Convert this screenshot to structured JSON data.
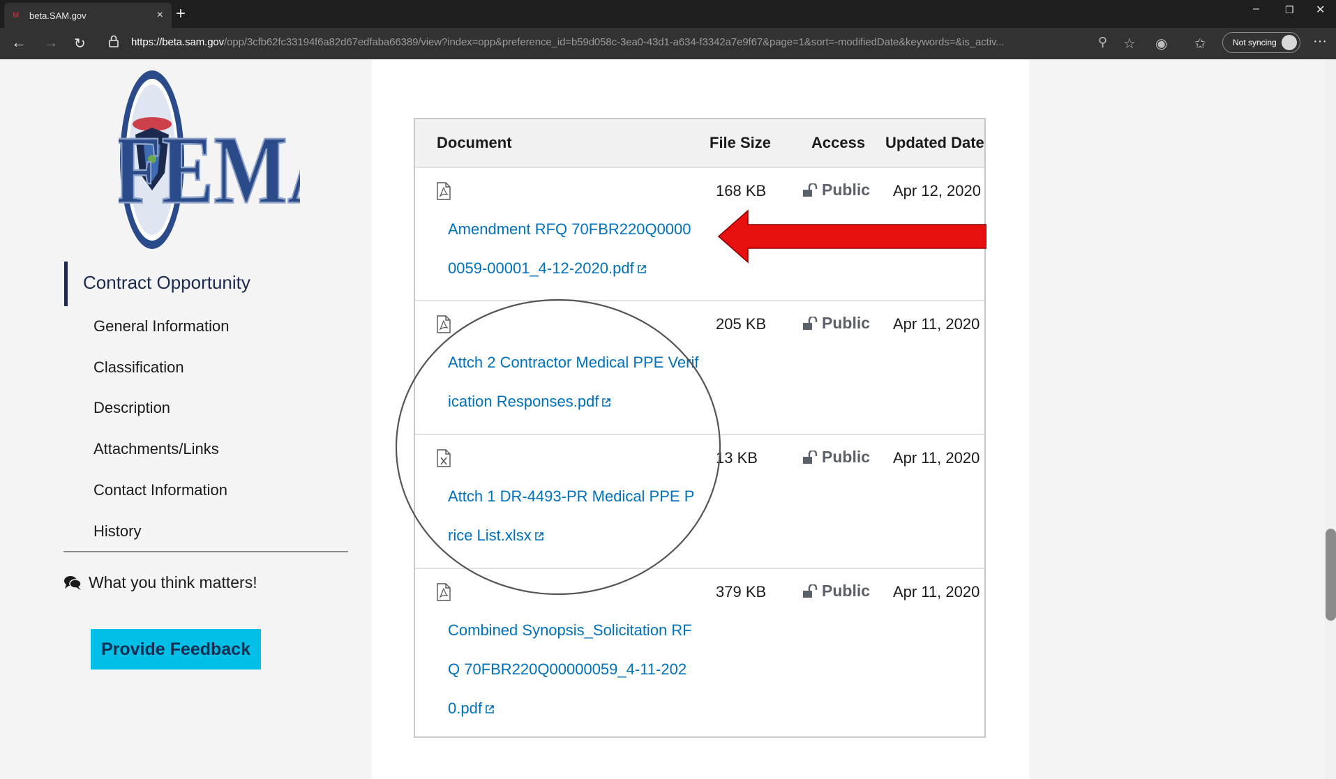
{
  "browser": {
    "tab_title": "beta.SAM.gov",
    "tab_close": "×",
    "new_tab": "+",
    "url_host": "https://beta.sam.gov",
    "url_path": "/opp/3cfb62fc33194f6a82d67edfaba66389/view?index=opp&preference_id=b59d058c-3ea0-43d1-a634-f3342a7e9f67&page=1&sort=-modifiedDate&keywords=&is_activ...",
    "sync_label": "Not syncing",
    "minimize": "–",
    "restore": "❐",
    "close": "✕",
    "menu": "···"
  },
  "sidebar": {
    "logo_text": "FEMA",
    "title": "Contract Opportunity",
    "items": [
      {
        "label": "General Information"
      },
      {
        "label": "Classification"
      },
      {
        "label": "Description"
      },
      {
        "label": "Attachments/Links"
      },
      {
        "label": "Contact Information"
      },
      {
        "label": "History"
      }
    ],
    "feedback_prompt": "What you think matters!",
    "feedback_button": "Provide Feedback"
  },
  "attachments": {
    "headers": {
      "document": "Document",
      "file_size": "File Size",
      "access": "Access",
      "updated_date": "Updated Date"
    },
    "rows": [
      {
        "icon": "pdf-file-icon",
        "name": "Amendment RFQ 70FBR220Q00000059-00001_4-12-2020.pdf",
        "size": "168 KB",
        "access": "Public",
        "date": "Apr 12, 2020"
      },
      {
        "icon": "pdf-file-icon",
        "name": "Attch 2 Contractor Medical PPE Verification Responses.pdf",
        "size": "205 KB",
        "access": "Public",
        "date": "Apr 11, 2020"
      },
      {
        "icon": "excel-file-icon",
        "name": "Attch 1 DR-4493-PR Medical PPE Price List.xlsx",
        "size": "13 KB",
        "access": "Public",
        "date": "Apr 11, 2020"
      },
      {
        "icon": "pdf-file-icon",
        "name": "Combined Synopsis_Solicitation RFQ 70FBR220Q00000059_4-11-2020.pdf",
        "size": "379 KB",
        "access": "Public",
        "date": "Apr 11, 2020"
      }
    ]
  },
  "colors": {
    "link": "#0071bc",
    "feedback_button": "#02bfe7",
    "annotation_arrow": "#e8100f",
    "sidebar_active": "#1b2a4e"
  }
}
